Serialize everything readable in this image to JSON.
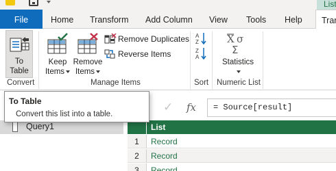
{
  "context_tab": {
    "label": "List"
  },
  "tabs": [
    {
      "label": "File"
    },
    {
      "label": "Home"
    },
    {
      "label": "Transform"
    },
    {
      "label": "Add Column"
    },
    {
      "label": "View"
    },
    {
      "label": "Tools"
    },
    {
      "label": "Help"
    },
    {
      "label": "Transform"
    }
  ],
  "ribbon": {
    "convert": {
      "to_table_line1": "To",
      "to_table_line2": "Table",
      "group_label": "Convert"
    },
    "manage_items": {
      "keep_items_line1": "Keep",
      "keep_items_line2": "Items",
      "remove_items_line1": "Remove",
      "remove_items_line2": "Items",
      "remove_duplicates": "Remove Duplicates",
      "reverse_items": "Reverse Items",
      "group_label": "Manage Items"
    },
    "sort": {
      "group_label": "Sort"
    },
    "numeric_list": {
      "statistics_label": "Statistics",
      "group_label": "Numeric List"
    }
  },
  "tooltip": {
    "title": "To Table",
    "description": "Convert this list into a table."
  },
  "formula_bar": {
    "fx_label": "fx",
    "formula": "= Source[result]"
  },
  "queries": [
    {
      "name": "Query1"
    }
  ],
  "grid": {
    "column_header": "List",
    "rows": [
      {
        "num": "1",
        "value": "Record"
      },
      {
        "num": "2",
        "value": "Record"
      },
      {
        "num": "3",
        "value": "Record"
      }
    ]
  },
  "colors": {
    "accent": "#0f6cbd",
    "context_green": "#217346",
    "context_tab_bg": "#c7e0d9"
  },
  "icons": {
    "app": "power-query-icon",
    "save": "save-icon",
    "to_table": "to-table-icon",
    "keep_items": "keep-items-icon",
    "remove_items": "remove-items-icon",
    "remove_duplicates": "remove-duplicates-icon",
    "reverse_items": "reverse-items-icon",
    "sort_ascending": "sort-ascending-icon",
    "sort_descending": "sort-descending-icon",
    "statistics": "statistics-icon"
  }
}
